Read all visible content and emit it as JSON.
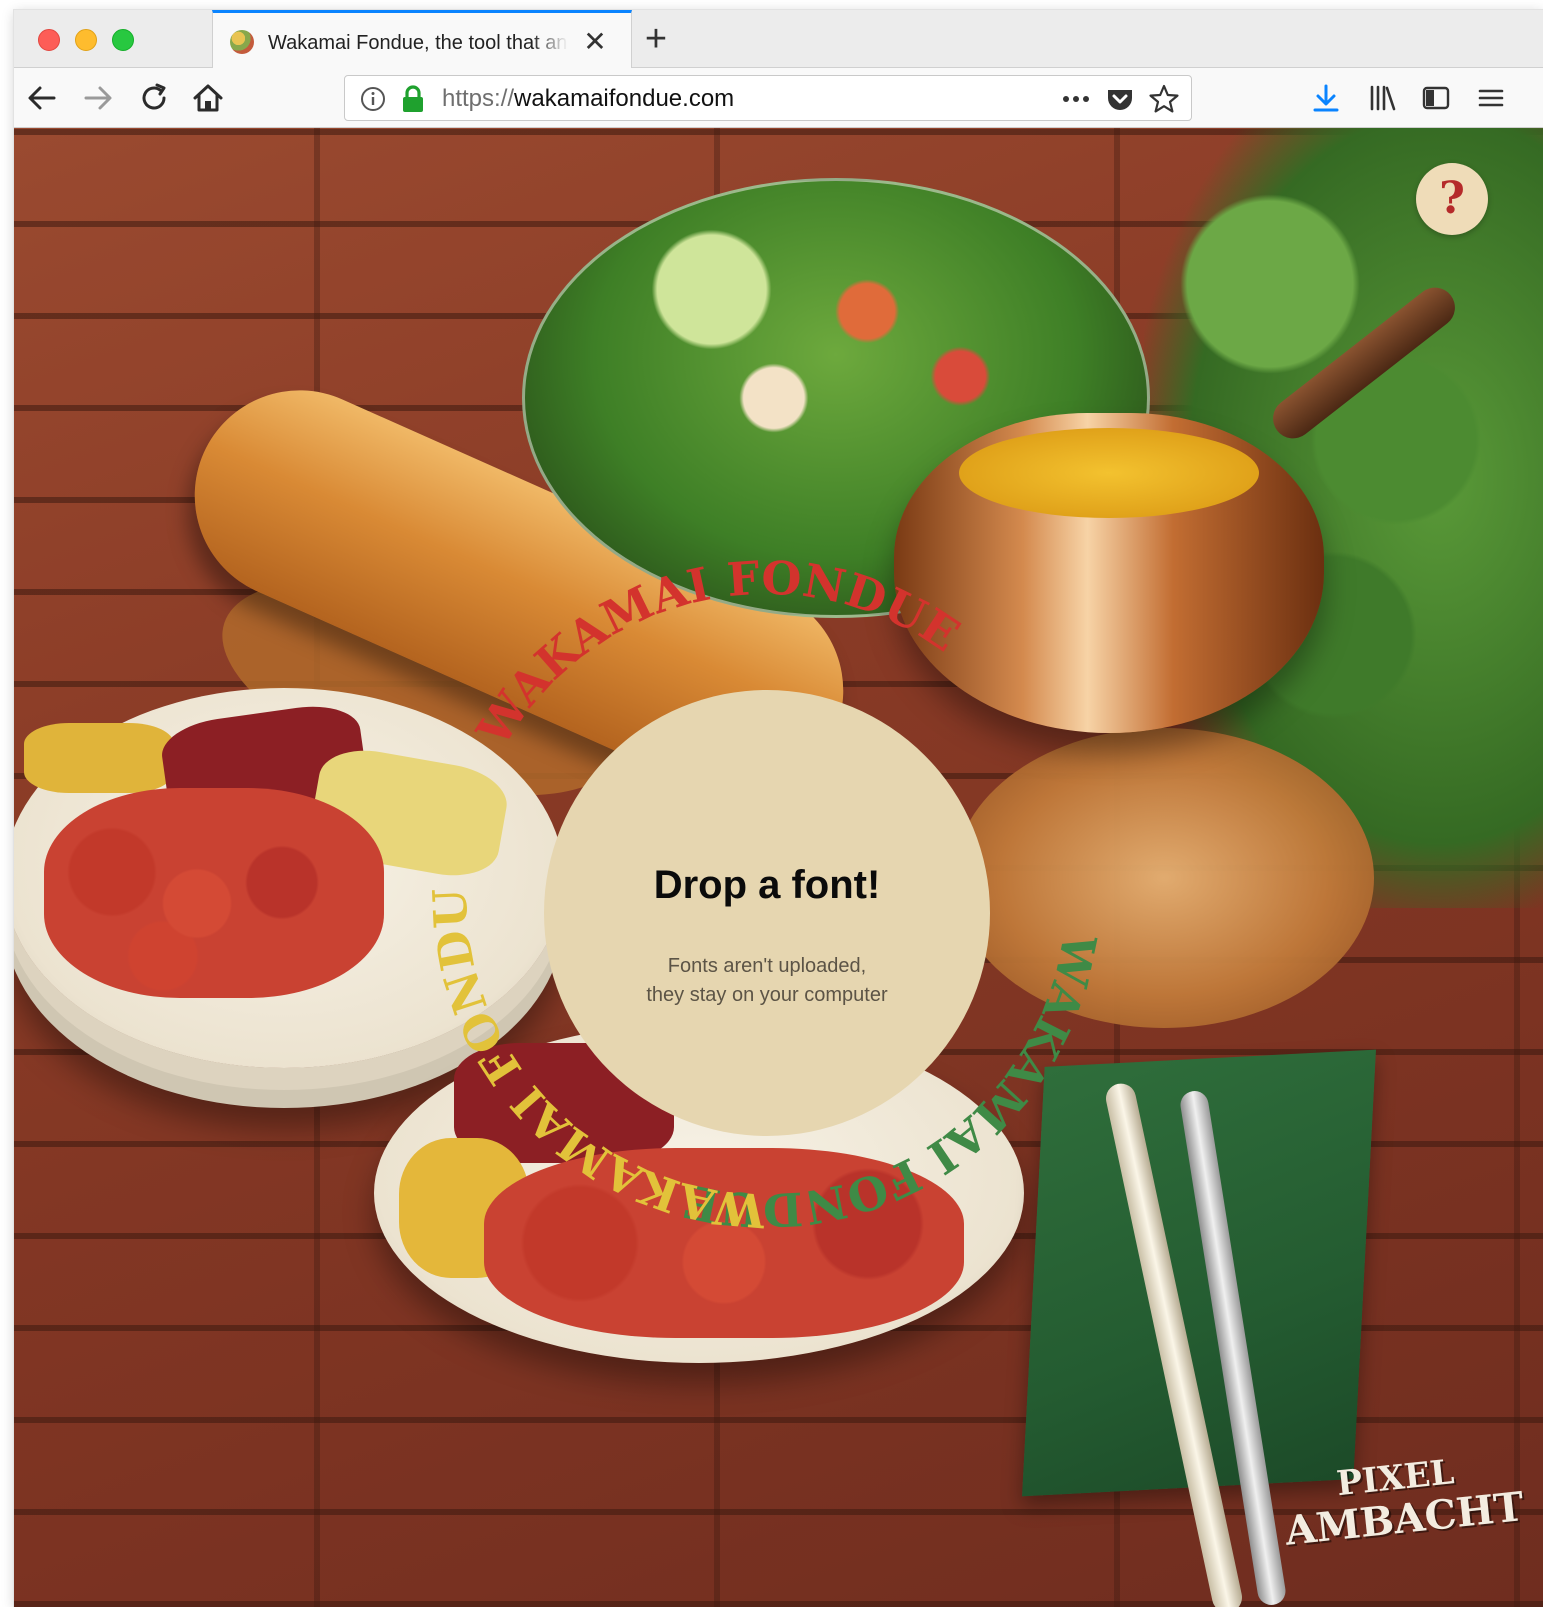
{
  "browser": {
    "tab": {
      "title": "Wakamai Fondue, the tool that answers the question \"What can my font do?\"",
      "close_glyph": "✕",
      "favicon_icon": "fondue-favicon"
    },
    "new_tab_glyph": "+",
    "nav": {
      "back_icon": "back-arrow-icon",
      "forward_icon": "forward-arrow-icon",
      "reload_icon": "reload-icon",
      "home_icon": "home-icon"
    },
    "url": {
      "scheme": "https://",
      "host": "wakamaifondue.com",
      "more_glyph": "•••"
    },
    "toolbar_icons": [
      "download-icon",
      "library-icon",
      "sidebar-icon",
      "menu-icon"
    ],
    "accent_color": "#0a84ff"
  },
  "page": {
    "help_label": "?",
    "ring_texts": {
      "top_right": "WAKAMAI FONDUE",
      "top_left": "WAKAMAI FONDUE",
      "bottom": "WAKAMAI FONDUE"
    },
    "ring_colors": {
      "yellow": "#e2c23a",
      "green": "#3f8a46",
      "red": "#d3332d"
    },
    "drop": {
      "title": "Drop a font!",
      "line1": "Fonts aren't uploaded,",
      "line2": "they stay on your computer"
    },
    "watermark": {
      "line1": "PIXEL",
      "line2": "AMBACHT"
    }
  }
}
